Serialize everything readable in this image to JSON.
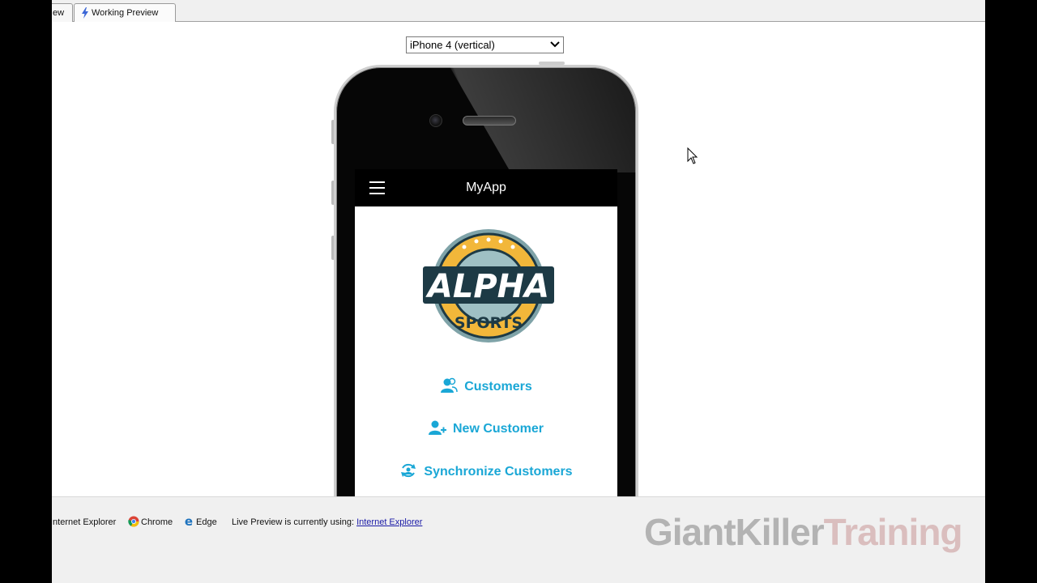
{
  "tabs": {
    "preview_partial": "ew",
    "working_preview": "Working Preview"
  },
  "device_select": {
    "selected": "iPhone 4 (vertical)"
  },
  "app": {
    "title": "MyApp",
    "logo": {
      "top_text": "ALPHA",
      "bottom_text": "SPORTS"
    },
    "menu": [
      {
        "label": "Customers",
        "icon": "users-icon"
      },
      {
        "label": "New Customer",
        "icon": "add-user-icon"
      },
      {
        "label": "Synchronize Customers",
        "icon": "sync-icon"
      }
    ],
    "accent_color": "#1aa7d6"
  },
  "browsers": {
    "ie": "Internet Explorer",
    "chrome": "Chrome",
    "edge": "Edge",
    "status_prefix": "Live Preview is currently using:",
    "status_link": "Internet Explorer"
  },
  "watermark": {
    "part1": "GiantKiller",
    "part2": "Training"
  }
}
